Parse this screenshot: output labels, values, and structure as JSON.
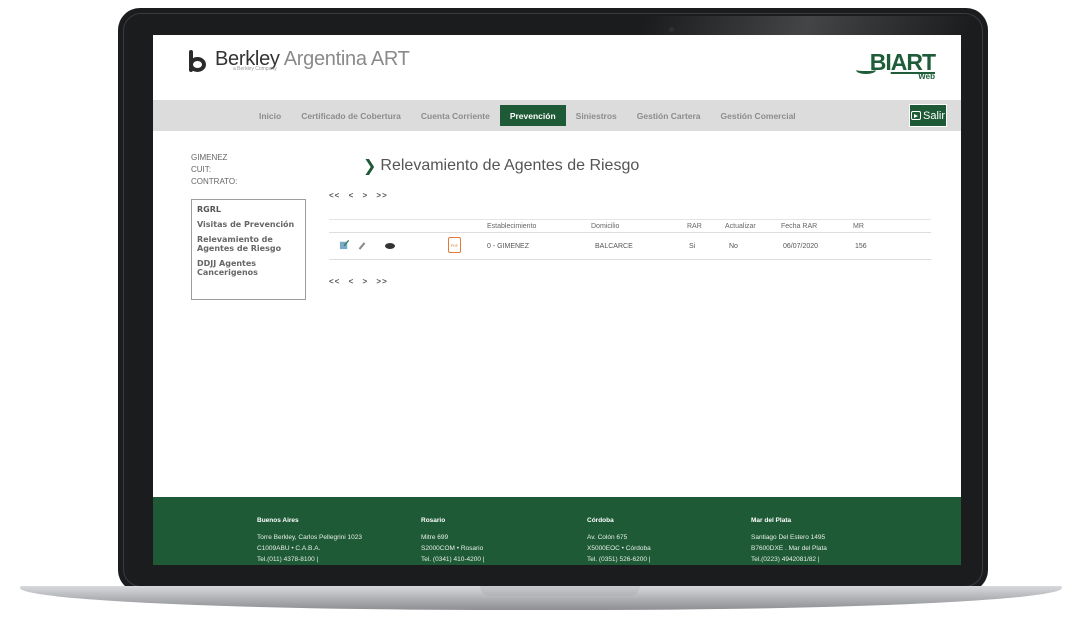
{
  "brand": {
    "name_bold": "Berkley",
    "name_light": "Argentina ART",
    "sub": "a Berkley Company"
  },
  "biart": {
    "logo_main": "BI",
    "logo_accent": "ART",
    "logo_sub": "Web"
  },
  "nav": {
    "items": [
      "Inicio",
      "Certificado de Cobertura",
      "Cuenta Corriente",
      "Prevención",
      "Siniestros",
      "Gestión Cartera",
      "Gestión Comercial"
    ],
    "active": "Prevención",
    "logout_label": "Salir"
  },
  "user_info": {
    "name": "GIMENEZ",
    "cuit_label": "CUIT:",
    "contrato_label": "CONTRATO:"
  },
  "sidebar": {
    "items": [
      "RGRL",
      "Visitas de Prevención",
      "Relevamiento de Agentes de Riesgo",
      "DDJJ Agentes Cancerigenos"
    ]
  },
  "page_title": "Relevamiento de Agentes de Riesgo",
  "pager": {
    "first": "<<",
    "prev": "<",
    "next": ">",
    "last": ">>"
  },
  "table": {
    "columns": [
      "Establecimiento",
      "Domicilio",
      "RAR",
      "Actualizar",
      "Fecha RAR",
      "MR"
    ],
    "rows": [
      {
        "establecimiento": "0 - GIMENEZ",
        "domicilio": "BALCARCE",
        "rar": "Si",
        "actualizar": "No",
        "fecha_rar": "06/07/2020",
        "mr": "156"
      }
    ],
    "row_icons": [
      "edit-icon",
      "pencil-icon",
      "eye-icon",
      "pdf-icon"
    ]
  },
  "footer": {
    "columns": [
      {
        "city": "Buenos Aires",
        "line1": "Torre Berkley, Carlos Pellegrini 1023",
        "line2": "C1009ABU • C.A.B.A.",
        "line3": "Tel.(011) 4378-8100 |"
      },
      {
        "city": "Rosario",
        "line1": "Mitre 699",
        "line2": "S2000COM • Rosario",
        "line3": "Tel. (0341) 410-4200 |"
      },
      {
        "city": "Córdoba",
        "line1": "Av. Colón 675",
        "line2": "X5000EOC • Córdoba",
        "line3": "Tel. (0351) 526-6200 |"
      },
      {
        "city": "Mar del Plata",
        "line1": "Santiago Del Estero 1495",
        "line2": "B7600DXE . Mar del Plata",
        "line3": "Tel.(0223) 4942081/82 |"
      }
    ]
  }
}
